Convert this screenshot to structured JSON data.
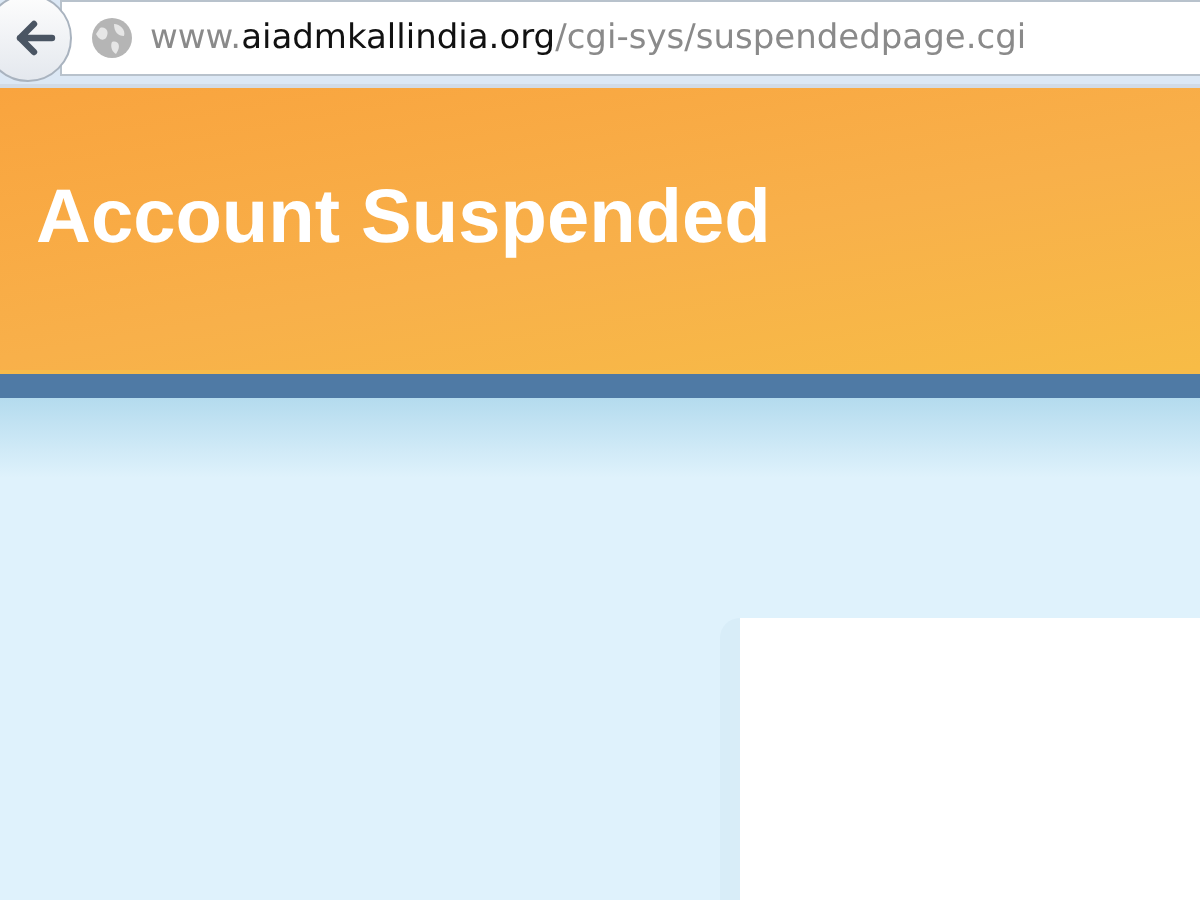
{
  "address_bar": {
    "url": "www.**aiadmkallindia.org**/cgi-sys/suspendedpage.cgi"
  },
  "header": {
    "title": "Account Suspended"
  }
}
